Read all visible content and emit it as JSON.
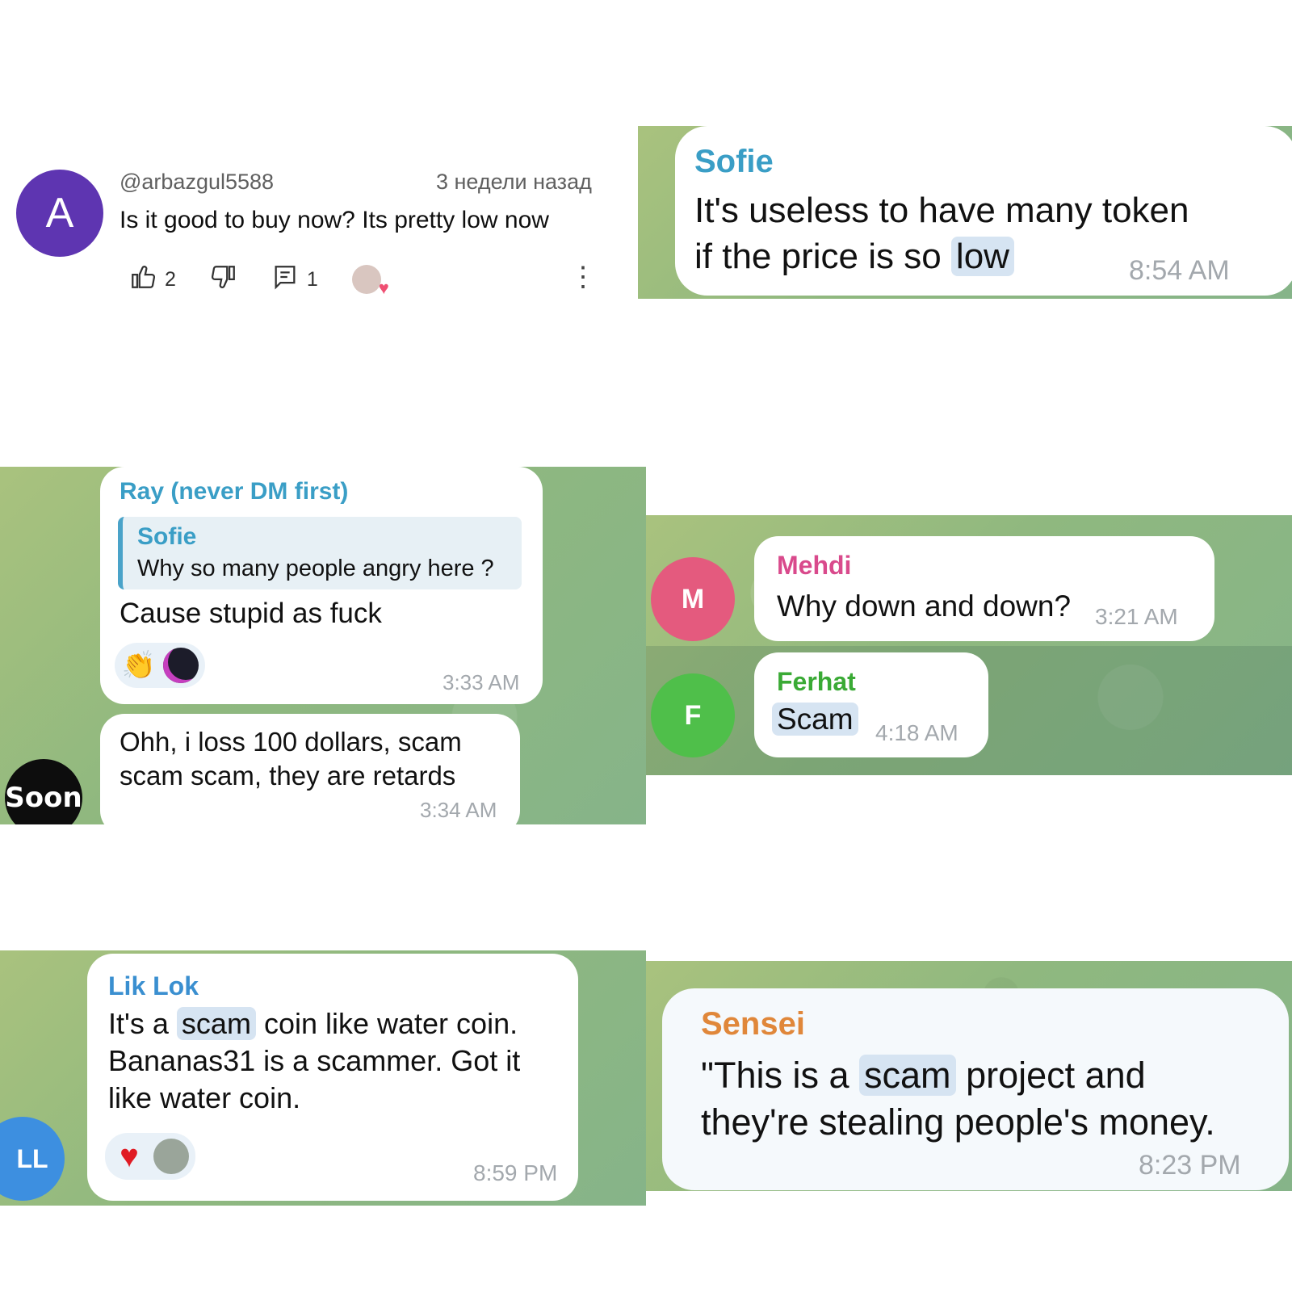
{
  "youtube_comment": {
    "avatar_letter": "A",
    "handle": "@arbazgul5588",
    "time": "3 недели назад",
    "text": "Is it good to buy now? Its pretty low now",
    "likes": "2",
    "replies": "1",
    "colors": {
      "avatar": "#5e35b1"
    }
  },
  "panel_sofie": {
    "name": "Sofie",
    "text_line1": "It's useless to have many token",
    "text_line2_pre": "if the price is so",
    "text_highlight": "low",
    "time": "8:54 AM",
    "name_color": "#3a9ec6"
  },
  "panel_ray": {
    "name": "Ray (never DM first)",
    "quote_name": "Sofie",
    "quote_text": "Why so many people angry here ?",
    "text": "Cause stupid as fuck",
    "time": "3:33 AM",
    "reactions": [
      "clapping-hands-emoji",
      "user-avatar"
    ],
    "second_text_line1": "Ohh, i loss 100 dollars, scam",
    "second_text_line2": "scam scam, they are retards",
    "second_time": "3:34 AM",
    "sender_avatar_text": "Soon"
  },
  "panel_mehdi": {
    "m_avatar": "M",
    "m_name": "Mehdi",
    "m_text": "Why down and down?",
    "m_time": "3:21 AM",
    "f_avatar": "F",
    "f_name": "Ferhat",
    "f_text": "Scam",
    "f_time": "4:18 AM",
    "colors": {
      "mehdi": "#d94a8c",
      "ferhat": "#3aaa35"
    }
  },
  "panel_liklok": {
    "avatar": "LL",
    "name": "Lik Lok",
    "line1_pre": "It's a",
    "line1_hl": "scam",
    "line1_post": "coin like  water coin.",
    "line2": "Bananas31 is a scammer. Got it",
    "line3": "like water coin.",
    "time": "8:59 PM",
    "reactions": [
      "red-heart-emoji",
      "user-avatar"
    ]
  },
  "panel_sensei": {
    "name": "Sensei",
    "line1_pre": "\"This is a",
    "line1_hl": "scam",
    "line1_post": "project and",
    "line2": "they're stealing people's money.",
    "time": "8:23 PM",
    "name_color": "#e0873a"
  }
}
